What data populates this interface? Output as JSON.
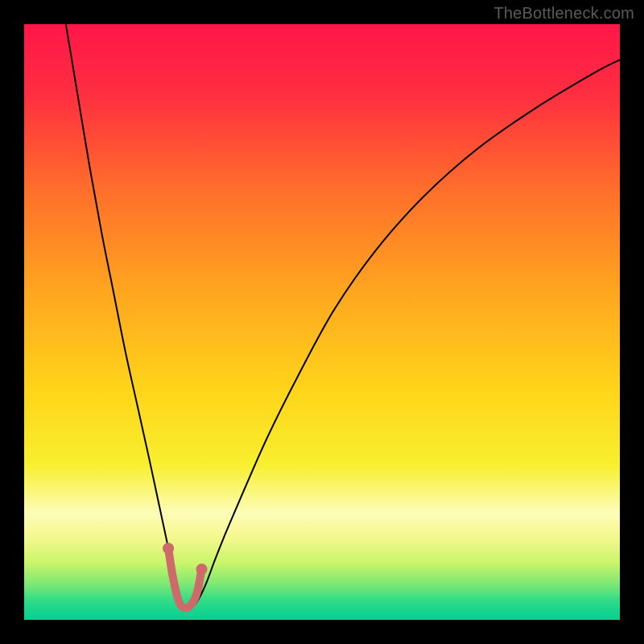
{
  "watermark": "TheBottleneck.com",
  "colors": {
    "frame": "#000000",
    "curve": "#000000",
    "marker_stroke": "#cf6a6a",
    "marker_fill": "#cf6a6a",
    "gradient_stops": [
      {
        "offset": 0.0,
        "color": "#ff1649"
      },
      {
        "offset": 0.12,
        "color": "#ff2f40"
      },
      {
        "offset": 0.28,
        "color": "#ff6f2a"
      },
      {
        "offset": 0.45,
        "color": "#ffa61f"
      },
      {
        "offset": 0.62,
        "color": "#ffd61a"
      },
      {
        "offset": 0.74,
        "color": "#f7ef2f"
      },
      {
        "offset": 0.82,
        "color": "#fdfdb8"
      },
      {
        "offset": 0.86,
        "color": "#f6f88f"
      },
      {
        "offset": 0.905,
        "color": "#c8f56a"
      },
      {
        "offset": 0.94,
        "color": "#7de874"
      },
      {
        "offset": 0.965,
        "color": "#36dd86"
      },
      {
        "offset": 0.985,
        "color": "#17d58e"
      },
      {
        "offset": 1.0,
        "color": "#09cf92"
      }
    ]
  },
  "chart_data": {
    "type": "line",
    "title": "",
    "xlabel": "",
    "ylabel": "",
    "xlim": [
      0,
      100
    ],
    "ylim": [
      0,
      100
    ],
    "series": [
      {
        "name": "bottleneck-curve",
        "x": [
          7,
          9,
          11,
          13,
          15,
          17,
          19,
          21,
          22.5,
          24,
          25,
          26,
          27,
          28,
          29,
          30.5,
          32,
          34,
          37,
          41,
          46,
          52,
          59,
          67,
          76,
          86,
          96,
          100
        ],
        "y": [
          100,
          88,
          76,
          65,
          55,
          45,
          36,
          27,
          20,
          13,
          8,
          4,
          2,
          2,
          3,
          6,
          10,
          15,
          22,
          31,
          41,
          52,
          62,
          71,
          79,
          86,
          92,
          94
        ]
      }
    ],
    "markers": {
      "name": "optimal-zone",
      "x": [
        24.2,
        25.0,
        26.0,
        27.0,
        28.0,
        29.0,
        29.8
      ],
      "y": [
        12.0,
        7.0,
        3.0,
        2.0,
        2.5,
        4.5,
        8.5
      ]
    }
  }
}
